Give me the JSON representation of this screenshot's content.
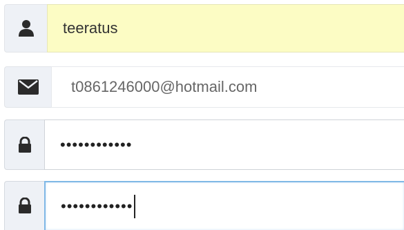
{
  "form": {
    "username": {
      "value": "teeratus",
      "icon": "user-icon"
    },
    "email": {
      "value": "t0861246000@hotmail.com",
      "icon": "envelope-icon"
    },
    "password": {
      "value": "••••••••••••",
      "icon": "lock-icon"
    },
    "confirm_password": {
      "value": "••••••••••••",
      "icon": "lock-icon"
    }
  },
  "colors": {
    "autofill_bg": "#fcfcc4",
    "addon_bg": "#eef1f6",
    "focus_border": "#7fb8e6",
    "icon": "#2b2b2b"
  }
}
